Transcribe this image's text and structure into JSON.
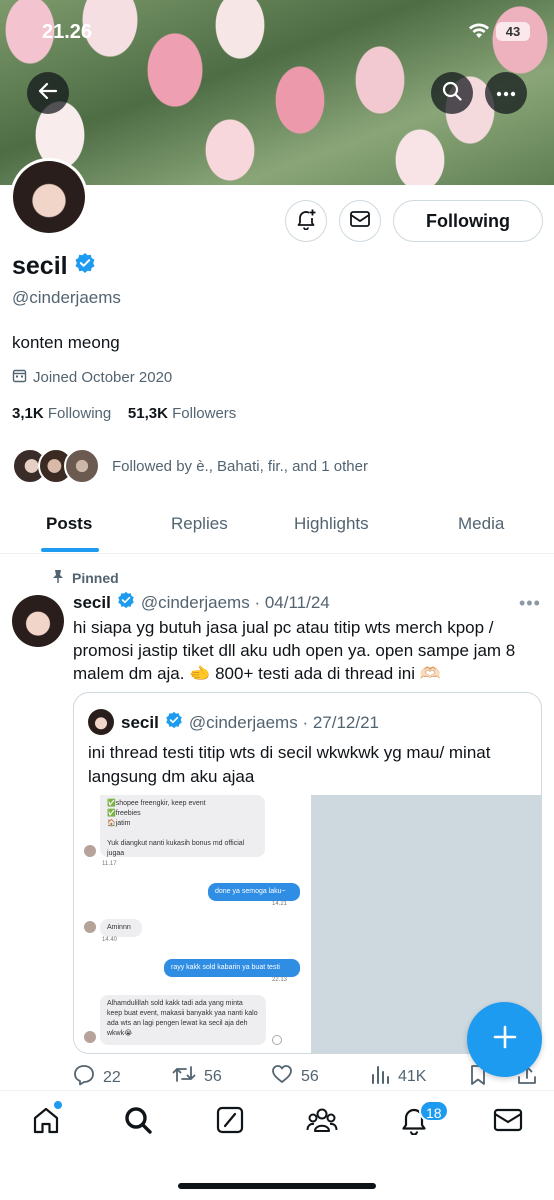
{
  "status_bar": {
    "time": "21.26",
    "battery": "43"
  },
  "profile": {
    "name": "secil",
    "handle": "@cinderjaems",
    "bio": "konten meong",
    "joined": "Joined October 2020",
    "following_count": "3,1K",
    "following_label": "Following",
    "followers_count": "51,3K",
    "followers_label": "Followers",
    "followed_by": "Followed by è., Bahati, fir., and 1 other",
    "follow_button": "Following"
  },
  "tabs": [
    {
      "label": "Posts",
      "active": true
    },
    {
      "label": "Replies"
    },
    {
      "label": "Highlights"
    },
    {
      "label": "Media"
    }
  ],
  "post": {
    "pinned_label": "Pinned",
    "name": "secil",
    "handle_date": "@cinderjaems · 04/11/24",
    "text": "hi siapa yg butuh jasa jual pc atau titip wts merch kpop / promosi jastip tiket dll aku udh open ya. open sampe jam 8 malem dm aja. 🫲 800+ testi ada di thread ini 🫶🏻",
    "quote": {
      "name": "secil",
      "handle_date": "@cinderjaems · 27/12/21",
      "text": "ini thread testi titip wts di secil wkwkwk yg mau/ minat langsung dm aku ajaa",
      "chat": {
        "msg1": "✅shopee freengkir, keep event\n✅freebies\n🏠jatim\n\nYuk diangkut nanti kukasih bonus md official jugaa",
        "ts1": "11.17",
        "msg2": "done ya semoga laku~",
        "ts2": "14.21",
        "msg3": "Aminnn",
        "ts3": "14.40",
        "msg4": "rayy kakk sold kabarin ya buat testi",
        "ts4": "22.13",
        "msg5": "Alhamdulillah sold kakk tadi ada yang minta keep buat event, makasii banyakk yaa nanti kalo ada wts an lagi pengen lewat ka secil aja deh wkwk😭"
      }
    },
    "replies": "22",
    "reposts": "56",
    "likes": "56",
    "views": "41K"
  },
  "nav": {
    "notifications_badge": "18"
  },
  "colors": {
    "accent": "#1d9bf0",
    "text": "#0f1419",
    "secondary": "#536471"
  }
}
